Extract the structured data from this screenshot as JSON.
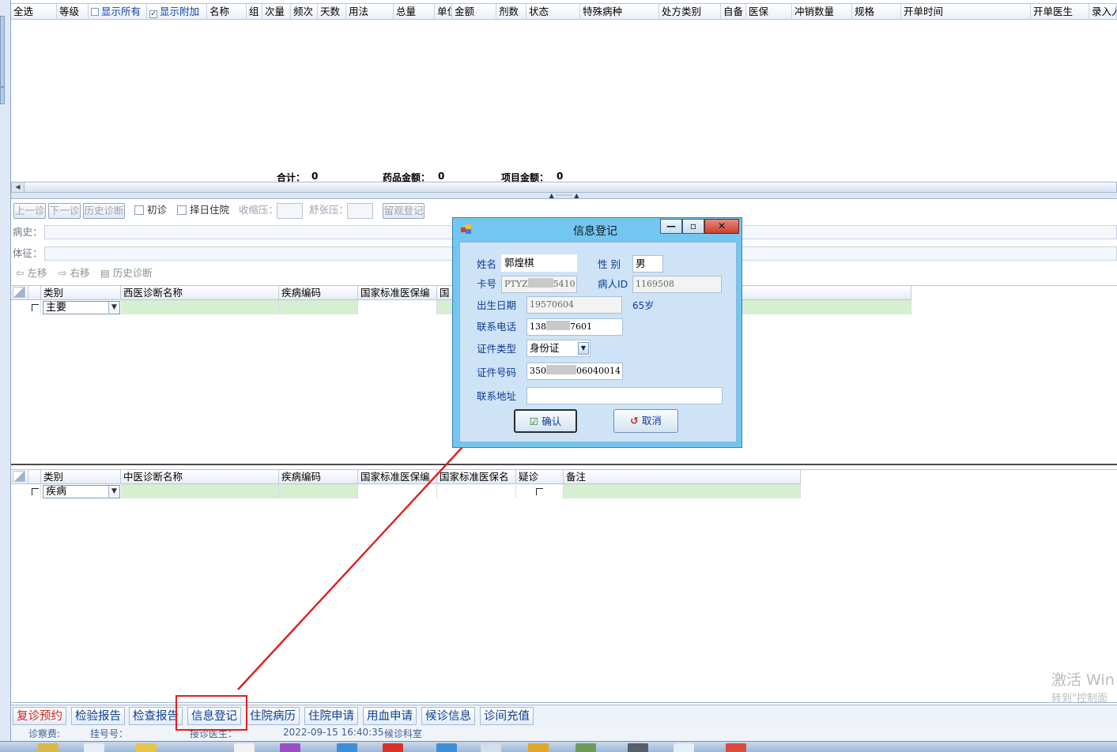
{
  "top_grid": {
    "headers": [
      "全选",
      "等级",
      "显示所有",
      "显示附加",
      "名称",
      "组",
      "次量",
      "频次",
      "天数",
      "用法",
      "总量",
      "单位",
      "金额",
      "剂数",
      "状态",
      "特殊病种",
      "处方类别",
      "自备",
      "医保",
      "冲销数量",
      "规格",
      "开单时间",
      "开单医生",
      "录入人"
    ],
    "show_all_checked": false,
    "show_extra_checked": true,
    "totals": {
      "sum_label": "合计：",
      "sum_value": "0",
      "drug_label": "药品金额：",
      "drug_value": "0",
      "item_label": "项目金额：",
      "item_value": "0"
    }
  },
  "toolbar": {
    "prev": "上一诊",
    "next": "下一诊",
    "history": "历史诊断",
    "first_visit": "初诊",
    "select_day_hospital": "择日住院",
    "systolic": "收缩压：",
    "diastolic": "舒张压：",
    "observe": "留观登记"
  },
  "fields": {
    "history_label": "病史：",
    "sign_label": "体征："
  },
  "toolbar2": {
    "left": "左移",
    "right": "右移",
    "history": "历史诊断"
  },
  "western_grid": {
    "headers": [
      "类别",
      "西医诊断名称",
      "疾病编码",
      "国家标准医保编",
      "国"
    ],
    "row_type": "主要"
  },
  "tcm_grid": {
    "headers": [
      "类别",
      "中医诊断名称",
      "疾病编码",
      "国家标准医保编",
      "国家标准医保名",
      "疑诊",
      "备注"
    ],
    "row_type": "疾病"
  },
  "tabs": [
    "复诊预约",
    "检验报告",
    "检查报告",
    "信息登记",
    "住院病历",
    "住院申请",
    "用血申请",
    "候诊信息",
    "诊间充值"
  ],
  "status": {
    "fee": "诊察费:",
    "reg": "挂号号：",
    "doctor": "接诊医生：",
    "datetime": "2022-09-15 16:40:35",
    "dept": "候诊科室"
  },
  "watermark": {
    "line1": "激活 Win",
    "line2": "转到\"控制面"
  },
  "dialog": {
    "title": "信息登记",
    "name_label": "姓名",
    "name_value": "郭煌棋",
    "gender_label": "性  别",
    "gender_value": "男",
    "card_label": "卡号",
    "card_prefix": "PTYZ",
    "card_suffix": "5410",
    "pid_label": "病人ID",
    "pid_value": "1169508",
    "dob_label": "出生日期",
    "dob_value": "19570604",
    "age": "65岁",
    "phone_label": "联系电话",
    "phone_prefix": "138",
    "phone_suffix": "7601",
    "idtype_label": "证件类型",
    "idtype_value": "身份证",
    "idno_label": "证件号码",
    "idno_prefix": "350",
    "idno_suffix": "06040014",
    "addr_label": "联系地址",
    "addr_value": "",
    "ok": "确认",
    "cancel": "取消"
  },
  "colors": {
    "annotation": "#e0201c",
    "dialog_frame": "#73c6ef",
    "tab_text": "#0b3f8f",
    "tab_red": "#d0261c"
  }
}
